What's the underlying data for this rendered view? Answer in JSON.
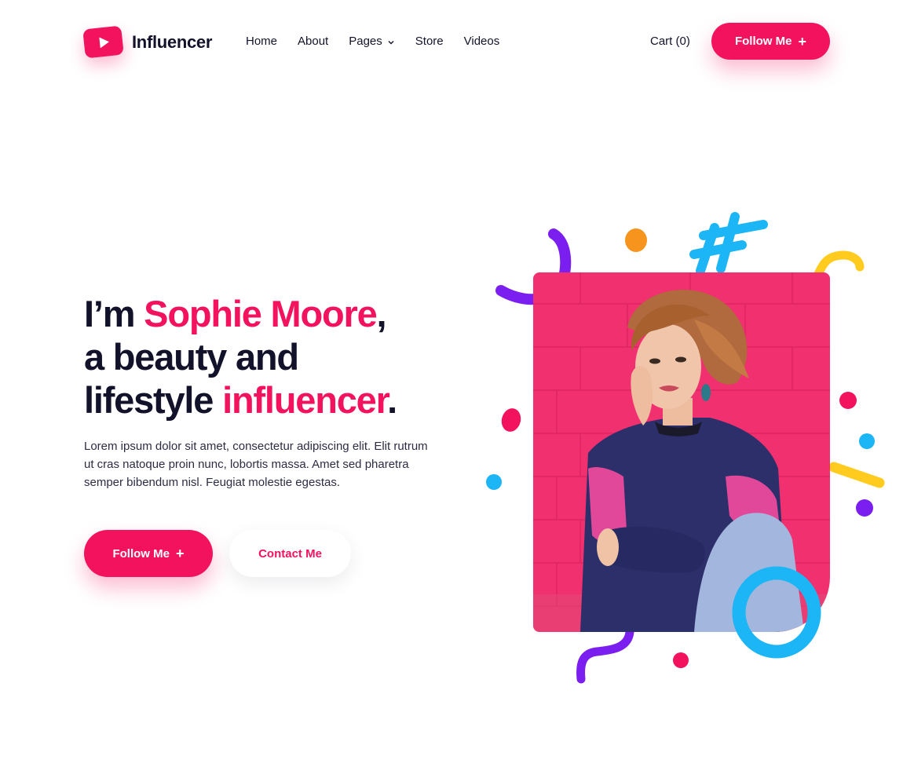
{
  "brand": {
    "name": "Influencer",
    "icon": "play-icon",
    "accent_color": "#f2125e",
    "text_color": "#12122b"
  },
  "nav": {
    "items": [
      {
        "label": "Home"
      },
      {
        "label": "About"
      },
      {
        "label": "Pages",
        "icon": "chevron-down-icon"
      },
      {
        "label": "Store"
      },
      {
        "label": "Videos"
      }
    ],
    "cart_label": "Cart (0)",
    "follow_label": "Follow Me",
    "follow_icon": "plus-icon"
  },
  "hero": {
    "title_part1": "I’m ",
    "title_name": "Sophie Moore",
    "title_part2": ",",
    "title_line2": "a beauty and",
    "title_part3": "lifestyle ",
    "title_accent": "influencer",
    "title_end": ".",
    "paragraph": "Lorem ipsum dolor sit amet, consectetur adipiscing elit. Elit rutrum ut cras natoque proin nunc, lobortis massa. Amet sed pharetra semper bibendum nisl. Feugiat molestie egestas.",
    "follow_label": "Follow Me",
    "contact_label": "Contact Me"
  },
  "image": {
    "subject": "woman-portrait-photo",
    "background_color": "#f0306f",
    "decoration_colors": [
      "#7b1ff0",
      "#f7941d",
      "#1cb5f5",
      "#ffcb1f",
      "#f2125e"
    ]
  }
}
